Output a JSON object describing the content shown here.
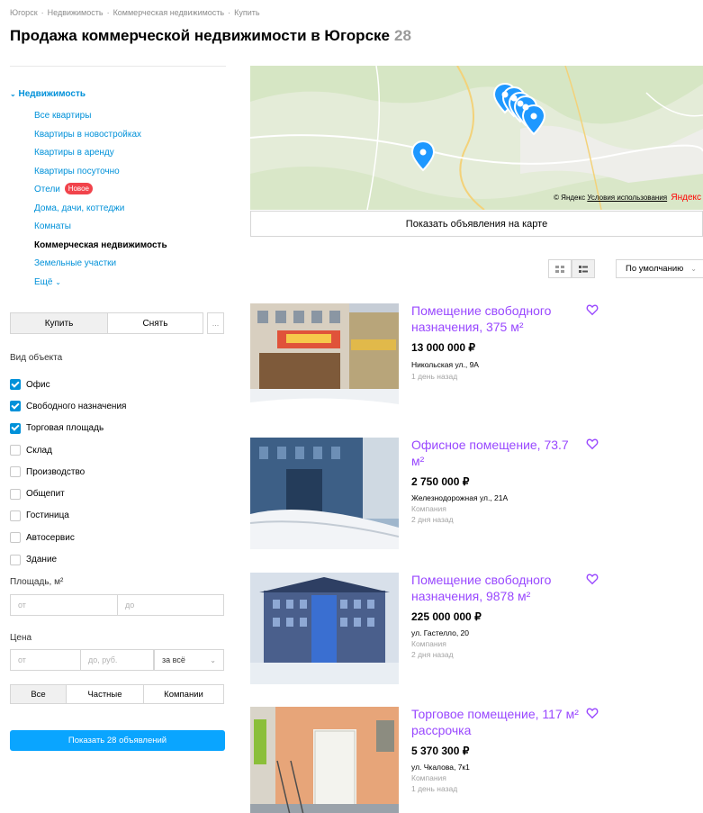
{
  "breadcrumbs": [
    "Югорск",
    "Недвижимость",
    "Коммерческая недвижимость",
    "Купить"
  ],
  "page_title": "Продажа коммерческой недвижимости в Югорске",
  "page_count": "28",
  "sidebar": {
    "root_label": "Недвижимость",
    "items": [
      {
        "label": "Все квартиры"
      },
      {
        "label": "Квартиры в новостройках"
      },
      {
        "label": "Квартиры в аренду"
      },
      {
        "label": "Квартиры посуточно"
      },
      {
        "label": "Отели",
        "badge": "Новое"
      },
      {
        "label": "Дома, дачи, коттеджи"
      },
      {
        "label": "Комнаты"
      },
      {
        "label": "Коммерческая недвижимость",
        "active": true
      },
      {
        "label": "Земельные участки"
      },
      {
        "label": "Ещё"
      }
    ]
  },
  "deal_toggle": {
    "buy": "Купить",
    "rent": "Снять",
    "more": "..."
  },
  "object_type": {
    "label": "Вид объекта",
    "options": [
      {
        "label": "Офис",
        "checked": true
      },
      {
        "label": "Свободного назначения",
        "checked": true
      },
      {
        "label": "Торговая площадь",
        "checked": true
      },
      {
        "label": "Склад",
        "checked": false
      },
      {
        "label": "Производство",
        "checked": false
      },
      {
        "label": "Общепит",
        "checked": false
      },
      {
        "label": "Гостиница",
        "checked": false
      },
      {
        "label": "Автосервис",
        "checked": false
      },
      {
        "label": "Здание",
        "checked": false
      }
    ]
  },
  "area": {
    "label": "Площадь, м²",
    "from_placeholder": "от",
    "to_placeholder": "до"
  },
  "price": {
    "label": "Цена",
    "from_placeholder": "от",
    "to_placeholder": "до, руб.",
    "period": "за всё"
  },
  "owner_toggle": {
    "all": "Все",
    "private": "Частные",
    "company": "Компании"
  },
  "show_button": "Показать 28 объявлений",
  "map": {
    "copyright": "© Яндекс",
    "terms": "Условия использования",
    "brand": "Яндекс",
    "show_on_map": "Показать объявления на карте"
  },
  "sort": {
    "selected": "По умолчанию"
  },
  "colors": {
    "accent": "#0091d9",
    "title_purple": "#9948ff",
    "badge_red": "#f1434b",
    "button_blue": "#0aa5ff"
  },
  "listings": [
    {
      "title": "Помещение свободного назначения, 375 м²",
      "price": "13 000 000 ₽",
      "address": "Никольская ул., 9А",
      "company": "",
      "time": "1 день назад"
    },
    {
      "title": "Офисное помещение, 73.7 м²",
      "price": "2 750 000 ₽",
      "address": "Железнодорожная ул., 21А",
      "company": "Компания",
      "time": "2 дня назад"
    },
    {
      "title": "Помещение свободного назначения, 9878 м²",
      "price": "225 000 000 ₽",
      "address": "ул. Гастелло, 20",
      "company": "Компания",
      "time": "2 дня назад"
    },
    {
      "title": "Торговое помещение, 117 м² рассрочка",
      "price": "5 370 300 ₽",
      "address": "ул. Чкалова, 7к1",
      "company": "Компания",
      "time": "1 день назад"
    }
  ]
}
